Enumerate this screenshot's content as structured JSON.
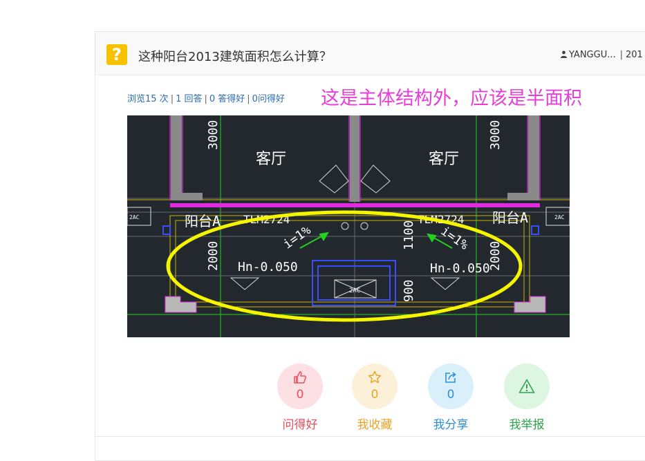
{
  "question": {
    "icon": "question-mark-icon",
    "icon_glyph": "?",
    "title": "这种阳台2013建筑面积怎么计算？",
    "author": "YANGGU...",
    "date_fragment": "201"
  },
  "stats": {
    "views": "浏览15 次",
    "answers": "1 回答",
    "answer_likes": "0 答得好",
    "question_likes": "0问得好",
    "separator": "|"
  },
  "annotation_text": "这是主体结构外，应该是半面积",
  "drawing": {
    "room_left": "客厅",
    "room_right": "客厅",
    "balcony_left": "阳台A",
    "balcony_right": "阳台A",
    "window_left": "TLM2724",
    "window_right": "TLM2724",
    "slope_left": "i=1%",
    "slope_right": "i=1%",
    "elev_left": "Hn-0.050",
    "elev_right": "Hn-0.050",
    "dim_top_left": "3000",
    "dim_top_right": "3000",
    "dim_mid_left": "2000",
    "dim_mid_right": "2000",
    "dim_1100": "1100",
    "dim_900": "900",
    "ac_center": "2AC",
    "ac_left": "2AC",
    "ac_right": "2AC",
    "colors": {
      "background": "#23282e",
      "wall": "#8a8a8a",
      "highlight_line": "#e02be0",
      "highlight_ellipse": "#f5f500",
      "grid": "#23d023",
      "text": "#ffffff"
    }
  },
  "actions": [
    {
      "name": "like",
      "icon": "thumbs-up-icon",
      "count": "0",
      "label": "问得好",
      "color": "#e94e5f",
      "bg": "#fde0e4"
    },
    {
      "name": "favorite",
      "icon": "star-icon",
      "count": "0",
      "label": "我收藏",
      "color": "#e8a42a",
      "bg": "#fdf0d8"
    },
    {
      "name": "share",
      "icon": "share-icon",
      "count": "0",
      "label": "我分享",
      "color": "#2f8ed6",
      "bg": "#d9f0fb"
    },
    {
      "name": "report",
      "icon": "warning-icon",
      "count": "",
      "label": "我举报",
      "color": "#2fa44a",
      "bg": "#dcf6e2"
    }
  ]
}
